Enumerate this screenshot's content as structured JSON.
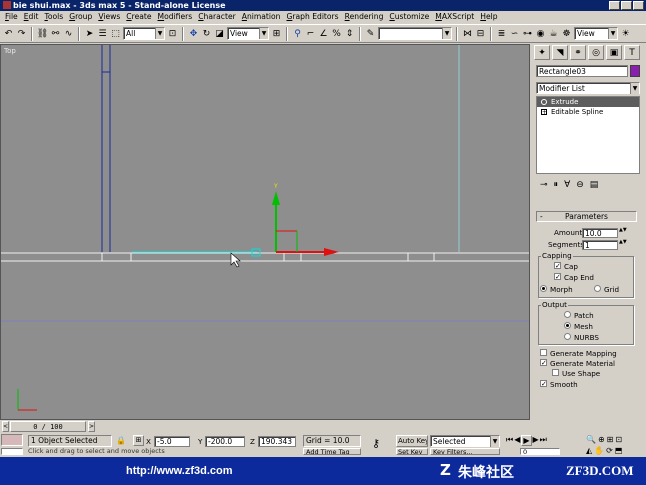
{
  "window": {
    "title": "bie shui.max - 3ds max 5 - Stand-alone License"
  },
  "menu": [
    "File",
    "Edit",
    "Tools",
    "Group",
    "Views",
    "Create",
    "Modifiers",
    "Character",
    "Animation",
    "Graph Editors",
    "Rendering",
    "Customize",
    "MAXScript",
    "Help"
  ],
  "toolbar": {
    "selection_filter": "All",
    "ref_coord": "View",
    "named_selection": "",
    "view_dropdown": "View"
  },
  "viewport": {
    "label": "Top",
    "gizmo_y_label": "Y"
  },
  "command_panel": {
    "object_name": "Rectangle03",
    "object_color": "#8a1fb0",
    "modifier_list": "Modifier List",
    "stack": [
      "Extrude",
      "Editable Spline"
    ],
    "rollout_title": "Parameters",
    "amount_label": "Amount:",
    "amount_value": "10.0",
    "segments_label": "Segments:",
    "segments_value": "1",
    "capping_group": "Capping",
    "cap_start": "Cap",
    "cap_end": "Cap End",
    "morph": "Morph",
    "grid": "Grid",
    "output_group": "Output",
    "patch": "Patch",
    "mesh": "Mesh",
    "nurbs": "NURBS",
    "gen_mapping": "Generate Mapping",
    "gen_material": "Generate Material",
    "use_shape": "Use Shape",
    "smooth": "Smooth"
  },
  "timeline": {
    "frame_readout": "0 / 100"
  },
  "status": {
    "selection": "1 Object Selected",
    "prompt": "Click and drag to select and move objects",
    "x_label": "X",
    "x_value": "-5.0",
    "y_label": "Y",
    "y_value": "-200.0",
    "z_label": "Z",
    "z_value": "190.343",
    "grid": "Grid = 10.0",
    "add_time_tag": "Add Time Tag",
    "auto_key": "Auto Key",
    "set_key": "Set Key",
    "key_filters": "Key Filters...",
    "selected_dropdown": "Selected",
    "frame_field": "0"
  },
  "watermark": {
    "url": "http://www.zf3d.com",
    "brand_cn": "朱峰社区",
    "brand_en": "ZF3D.COM"
  },
  "colors": {
    "title_bar": "#0a246a",
    "viewport_bg": "#8e8e8e",
    "gizmo_x": "#e01010",
    "gizmo_y": "#00c000",
    "selection_cyan": "#00e0e0",
    "watermark_bar": "#0d2a9c"
  }
}
